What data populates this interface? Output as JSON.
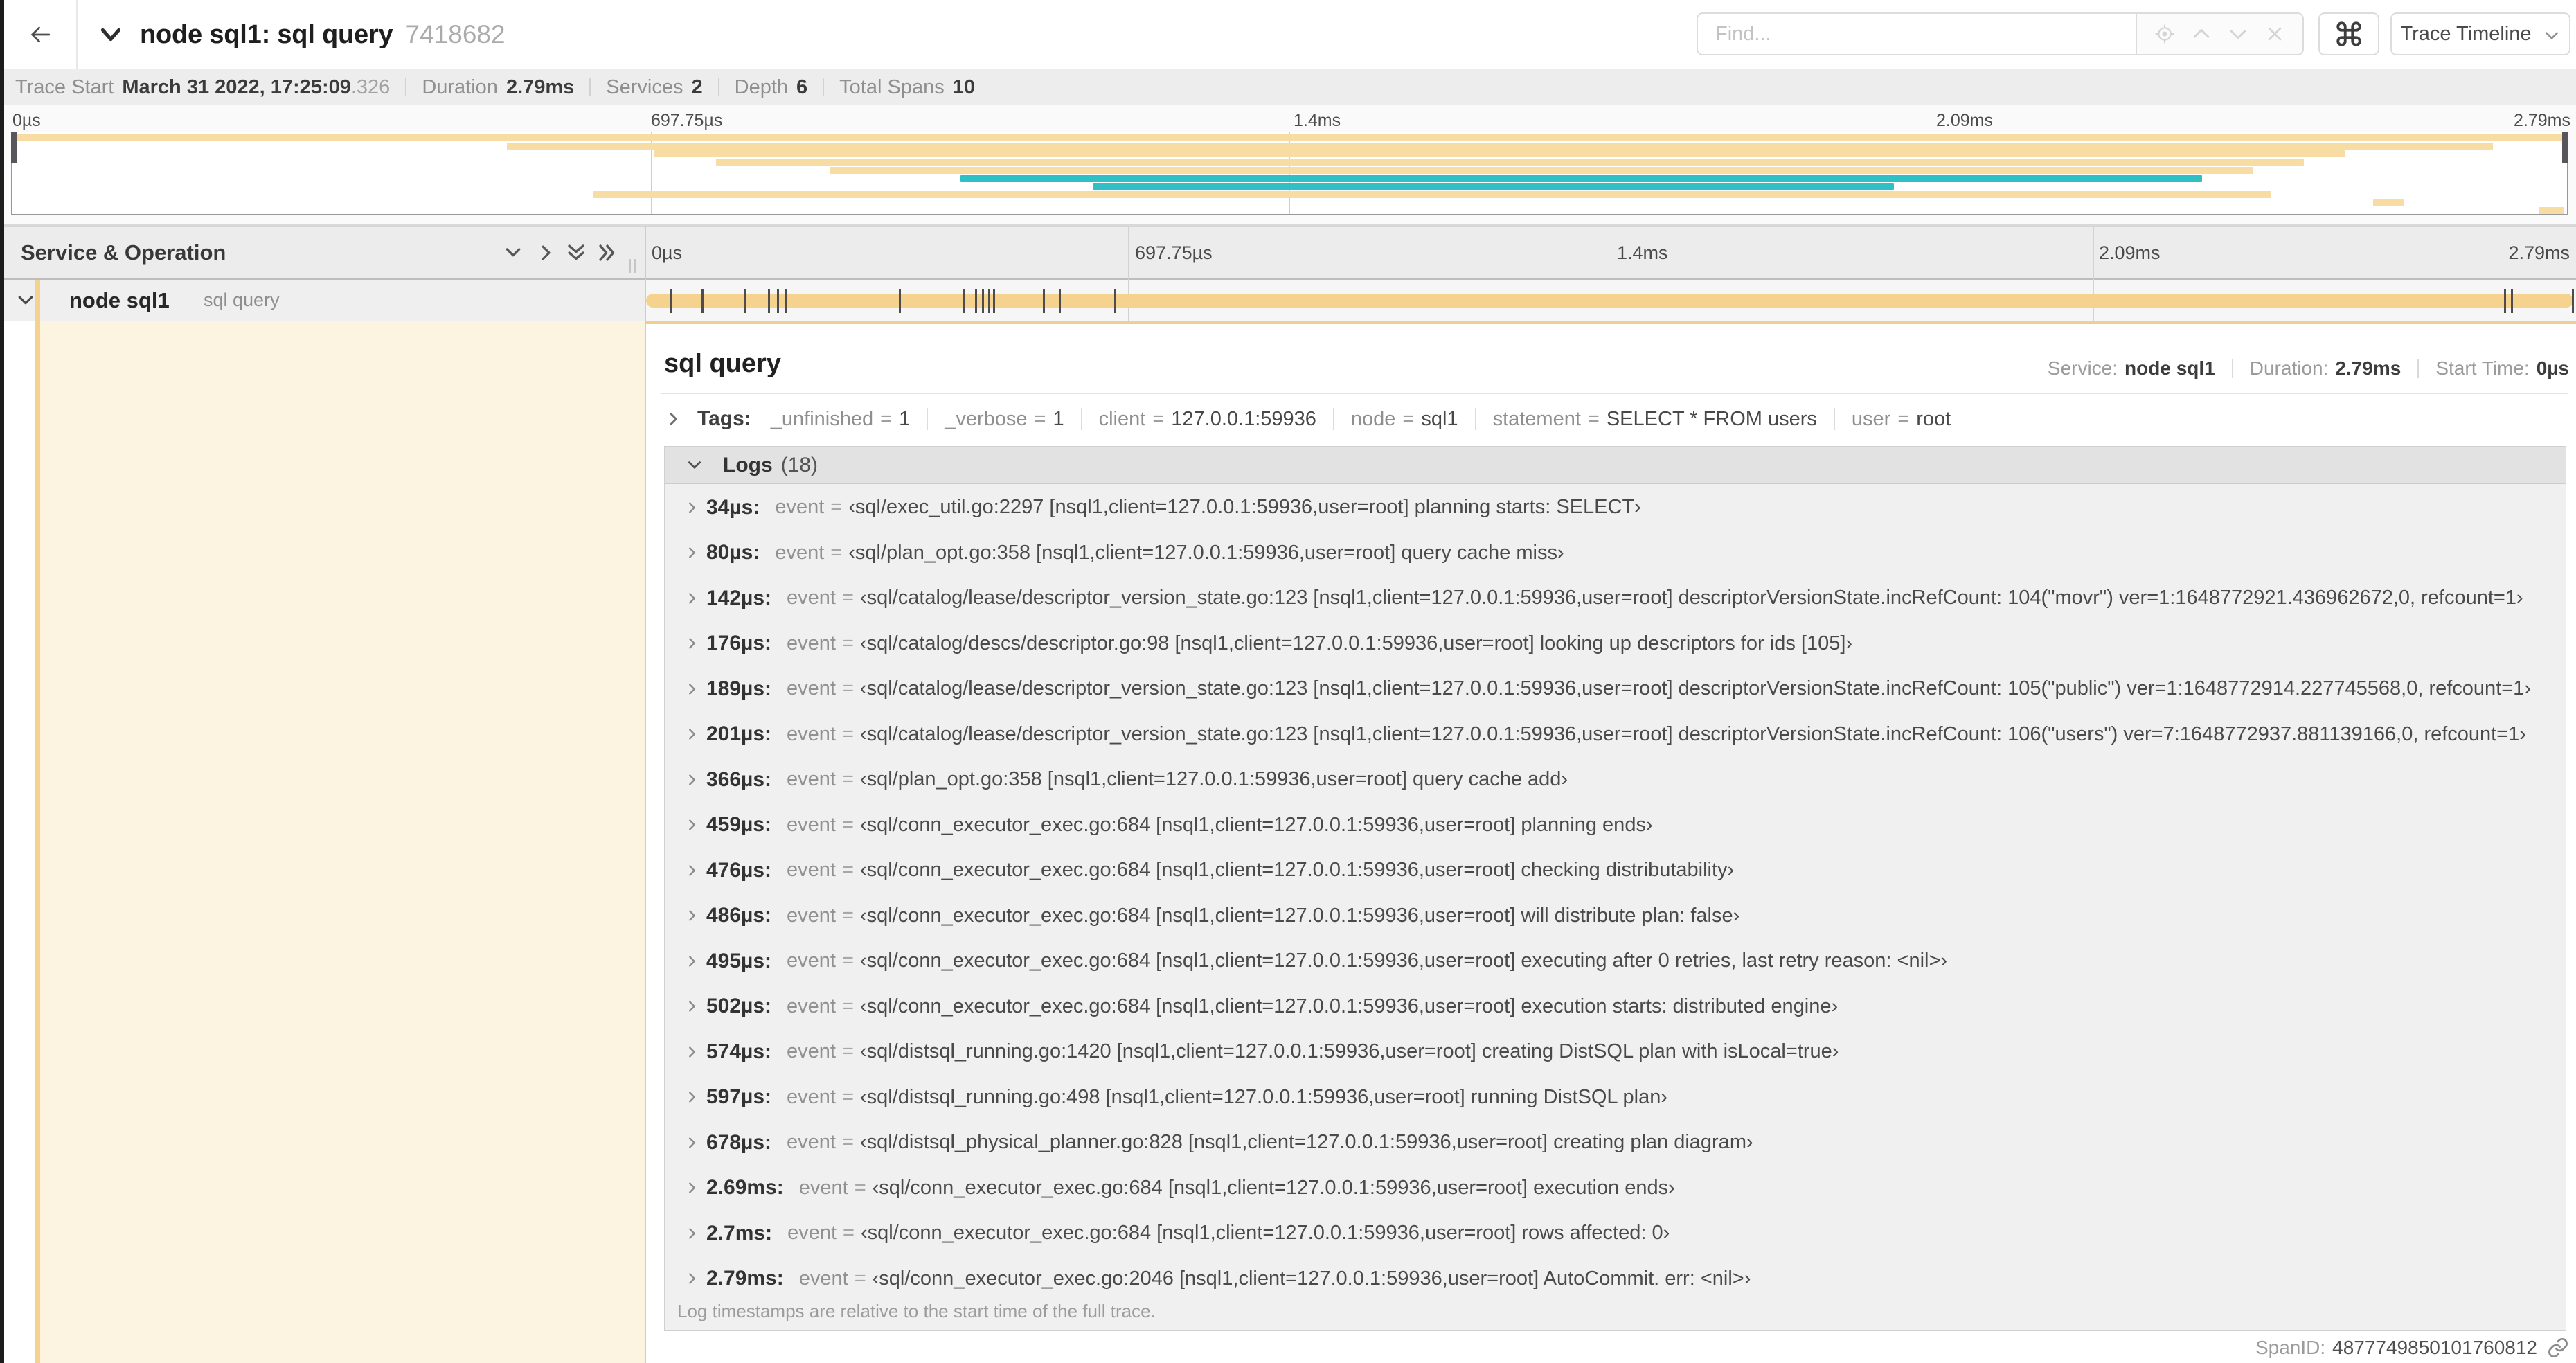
{
  "header": {
    "back_icon": "arrow-left",
    "title": "node sql1: sql query",
    "trace_id": "7418682",
    "find_placeholder": "Find...",
    "find_value": "",
    "suffix_icons": [
      "locate-icon",
      "chevron-up-icon",
      "chevron-down-icon",
      "close-icon"
    ],
    "shortcut_icon": "command",
    "view_selector": "Trace Timeline"
  },
  "trace_stats": [
    {
      "label": "Trace Start",
      "value": "March 31 2022, 17:25:09",
      "suffix": ".326"
    },
    {
      "label": "Duration",
      "value": "2.79ms"
    },
    {
      "label": "Services",
      "value": "2"
    },
    {
      "label": "Depth",
      "value": "6"
    },
    {
      "label": "Total Spans",
      "value": "10"
    }
  ],
  "minimap": {
    "tick_labels": [
      "0µs",
      "697.75µs",
      "1.4ms",
      "2.09ms",
      "2.79ms"
    ],
    "spans": [
      {
        "start": 0.0,
        "end": 1.0,
        "color": "yellow"
      },
      {
        "start": 0.193,
        "end": 0.972,
        "color": "yellow"
      },
      {
        "start": 0.251,
        "end": 0.914,
        "color": "yellow"
      },
      {
        "start": 0.275,
        "end": 0.898,
        "color": "yellow"
      },
      {
        "start": 0.32,
        "end": 0.878,
        "color": "yellow"
      },
      {
        "start": 0.371,
        "end": 0.858,
        "color": "teal"
      },
      {
        "start": 0.423,
        "end": 0.737,
        "color": "teal"
      },
      {
        "start": 0.227,
        "end": 0.885,
        "color": "yellow"
      },
      {
        "start": 0.925,
        "end": 0.937,
        "color": "yellow"
      },
      {
        "start": 0.99,
        "end": 1.0,
        "color": "yellow"
      }
    ]
  },
  "colors": {
    "yellow": "#f7dca3",
    "teal": "#2fc0c5",
    "bar_yellow": "#f6d28f",
    "accent": "#f6d28f",
    "detail_border": "#f0ce8e",
    "cream": "#fcf3e1"
  },
  "timeline": {
    "column_title": "Service & Operation",
    "collapse_icons": [
      "chevron-down-icon",
      "chevron-right-icon",
      "double-chevron-down-icon",
      "double-chevron-right-icon"
    ],
    "axis_labels": [
      "0µs",
      "697.75µs",
      "1.4ms",
      "2.09ms",
      "2.79ms"
    ],
    "total_duration_us": 2790
  },
  "span_row": {
    "service": "node sql1",
    "operation": "sql query",
    "bar_start": 0.0,
    "bar_end": 1.0,
    "log_ticks_us": [
      34,
      80,
      142,
      176,
      189,
      201,
      366,
      459,
      476,
      486,
      495,
      502,
      574,
      597,
      678,
      2690,
      2700,
      2790
    ]
  },
  "span_detail": {
    "title": "sql query",
    "info": [
      {
        "label": "Service:",
        "value": "node sql1"
      },
      {
        "label": "Duration:",
        "value": "2.79ms"
      },
      {
        "label": "Start Time:",
        "value": "0µs"
      }
    ],
    "tags_title": "Tags:",
    "tags": [
      {
        "key": "_unfinished",
        "value": "1"
      },
      {
        "key": "_verbose",
        "value": "1"
      },
      {
        "key": "client",
        "value": "127.0.0.1:59936"
      },
      {
        "key": "node",
        "value": "sql1"
      },
      {
        "key": "statement",
        "value": "SELECT * FROM users"
      },
      {
        "key": "user",
        "value": "root"
      }
    ],
    "logs_title": "Logs",
    "logs_count": "(18)",
    "logs": [
      {
        "time": "34µs:",
        "key": "event",
        "value": "‹sql/exec_util.go:2297 [nsql1,client=127.0.0.1:59936,user=root] planning starts: SELECT›"
      },
      {
        "time": "80µs:",
        "key": "event",
        "value": "‹sql/plan_opt.go:358 [nsql1,client=127.0.0.1:59936,user=root] query cache miss›"
      },
      {
        "time": "142µs:",
        "key": "event",
        "value": "‹sql/catalog/lease/descriptor_version_state.go:123 [nsql1,client=127.0.0.1:59936,user=root] descriptorVersionState.incRefCount: 104(\"movr\") ver=1:1648772921.436962672,0, refcount=1›"
      },
      {
        "time": "176µs:",
        "key": "event",
        "value": "‹sql/catalog/descs/descriptor.go:98 [nsql1,client=127.0.0.1:59936,user=root] looking up descriptors for ids [105]›"
      },
      {
        "time": "189µs:",
        "key": "event",
        "value": "‹sql/catalog/lease/descriptor_version_state.go:123 [nsql1,client=127.0.0.1:59936,user=root] descriptorVersionState.incRefCount: 105(\"public\") ver=1:1648772914.227745568,0, refcount=1›"
      },
      {
        "time": "201µs:",
        "key": "event",
        "value": "‹sql/catalog/lease/descriptor_version_state.go:123 [nsql1,client=127.0.0.1:59936,user=root] descriptorVersionState.incRefCount: 106(\"users\") ver=7:1648772937.881139166,0, refcount=1›"
      },
      {
        "time": "366µs:",
        "key": "event",
        "value": "‹sql/plan_opt.go:358 [nsql1,client=127.0.0.1:59936,user=root] query cache add›"
      },
      {
        "time": "459µs:",
        "key": "event",
        "value": "‹sql/conn_executor_exec.go:684 [nsql1,client=127.0.0.1:59936,user=root] planning ends›"
      },
      {
        "time": "476µs:",
        "key": "event",
        "value": "‹sql/conn_executor_exec.go:684 [nsql1,client=127.0.0.1:59936,user=root] checking distributability›"
      },
      {
        "time": "486µs:",
        "key": "event",
        "value": "‹sql/conn_executor_exec.go:684 [nsql1,client=127.0.0.1:59936,user=root] will distribute plan: false›"
      },
      {
        "time": "495µs:",
        "key": "event",
        "value": "‹sql/conn_executor_exec.go:684 [nsql1,client=127.0.0.1:59936,user=root] executing after 0 retries, last retry reason: <nil>›"
      },
      {
        "time": "502µs:",
        "key": "event",
        "value": "‹sql/conn_executor_exec.go:684 [nsql1,client=127.0.0.1:59936,user=root] execution starts: distributed engine›"
      },
      {
        "time": "574µs:",
        "key": "event",
        "value": "‹sql/distsql_running.go:1420 [nsql1,client=127.0.0.1:59936,user=root] creating DistSQL plan with isLocal=true›"
      },
      {
        "time": "597µs:",
        "key": "event",
        "value": "‹sql/distsql_running.go:498 [nsql1,client=127.0.0.1:59936,user=root] running DistSQL plan›"
      },
      {
        "time": "678µs:",
        "key": "event",
        "value": "‹sql/distsql_physical_planner.go:828 [nsql1,client=127.0.0.1:59936,user=root] creating plan diagram›"
      },
      {
        "time": "2.69ms:",
        "key": "event",
        "value": "‹sql/conn_executor_exec.go:684 [nsql1,client=127.0.0.1:59936,user=root] execution ends›"
      },
      {
        "time": "2.7ms:",
        "key": "event",
        "value": "‹sql/conn_executor_exec.go:684 [nsql1,client=127.0.0.1:59936,user=root] rows affected: 0›"
      },
      {
        "time": "2.79ms:",
        "key": "event",
        "value": "‹sql/conn_executor_exec.go:2046 [nsql1,client=127.0.0.1:59936,user=root] AutoCommit. err: <nil>›"
      }
    ],
    "logs_note": "Log timestamps are relative to the start time of the full trace.",
    "span_id_label": "SpanID:",
    "span_id": "4877749850101760812"
  }
}
